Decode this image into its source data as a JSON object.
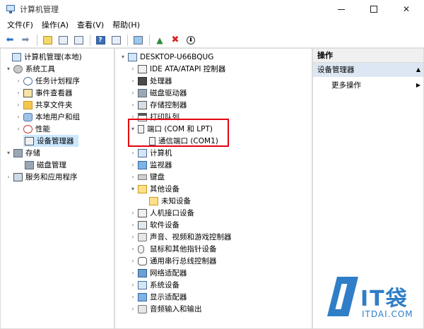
{
  "window": {
    "title": "计算机管理"
  },
  "menu": {
    "items": [
      "文件(F)",
      "操作(A)",
      "查看(V)",
      "帮助(H)"
    ]
  },
  "left_tree": [
    {
      "label": "计算机管理(本地)",
      "icon": "computer-management-icon"
    },
    {
      "label": "系统工具",
      "icon": "tools-icon"
    },
    {
      "label": "任务计划程序",
      "icon": "clock-icon"
    },
    {
      "label": "事件查看器",
      "icon": "event-viewer-icon"
    },
    {
      "label": "共享文件夹",
      "icon": "shared-folder-icon"
    },
    {
      "label": "本地用户和组",
      "icon": "users-icon"
    },
    {
      "label": "性能",
      "icon": "performance-icon"
    },
    {
      "label": "设备管理器",
      "icon": "device-manager-icon",
      "selected": true
    },
    {
      "label": "存储",
      "icon": "storage-icon"
    },
    {
      "label": "磁盘管理",
      "icon": "disk-icon"
    },
    {
      "label": "服务和应用程序",
      "icon": "services-icon"
    }
  ],
  "device_tree": {
    "root": "DESKTOP-U66BQUG",
    "items": [
      {
        "label": "IDE ATA/ATAPI 控制器",
        "icon": "ide-icon"
      },
      {
        "label": "处理器",
        "icon": "processor-icon"
      },
      {
        "label": "磁盘驱动器",
        "icon": "disk-drive-icon"
      },
      {
        "label": "存储控制器",
        "icon": "storage-controller-icon"
      },
      {
        "label": "打印队列",
        "icon": "printer-icon"
      },
      {
        "label": "端口 (COM 和 LPT)",
        "icon": "port-icon"
      },
      {
        "label": "通信端口 (COM1)",
        "icon": "com-port-icon"
      },
      {
        "label": "计算机",
        "icon": "computer-icon"
      },
      {
        "label": "监视器",
        "icon": "monitor-icon"
      },
      {
        "label": "键盘",
        "icon": "keyboard-icon"
      },
      {
        "label": "其他设备",
        "icon": "other-devices-icon"
      },
      {
        "label": "未知设备",
        "icon": "unknown-device-icon"
      },
      {
        "label": "人机接口设备",
        "icon": "hid-icon"
      },
      {
        "label": "软件设备",
        "icon": "software-device-icon"
      },
      {
        "label": "声音、视频和游戏控制器",
        "icon": "sound-icon"
      },
      {
        "label": "鼠标和其他指针设备",
        "icon": "mouse-icon"
      },
      {
        "label": "通用串行总线控制器",
        "icon": "usb-icon"
      },
      {
        "label": "网络适配器",
        "icon": "network-icon"
      },
      {
        "label": "系统设备",
        "icon": "system-device-icon"
      },
      {
        "label": "显示适配器",
        "icon": "display-adapter-icon"
      },
      {
        "label": "音频输入和输出",
        "icon": "audio-io-icon"
      }
    ]
  },
  "actions": {
    "header": "操作",
    "section": "设备管理器",
    "more": "更多操作"
  },
  "watermark": {
    "brand": "IT袋",
    "domain": "ITDAI.COM"
  },
  "colors": {
    "highlight_box": "#e60012",
    "selected_row": "#cce8ff",
    "watermark": "#2f7ec7"
  }
}
